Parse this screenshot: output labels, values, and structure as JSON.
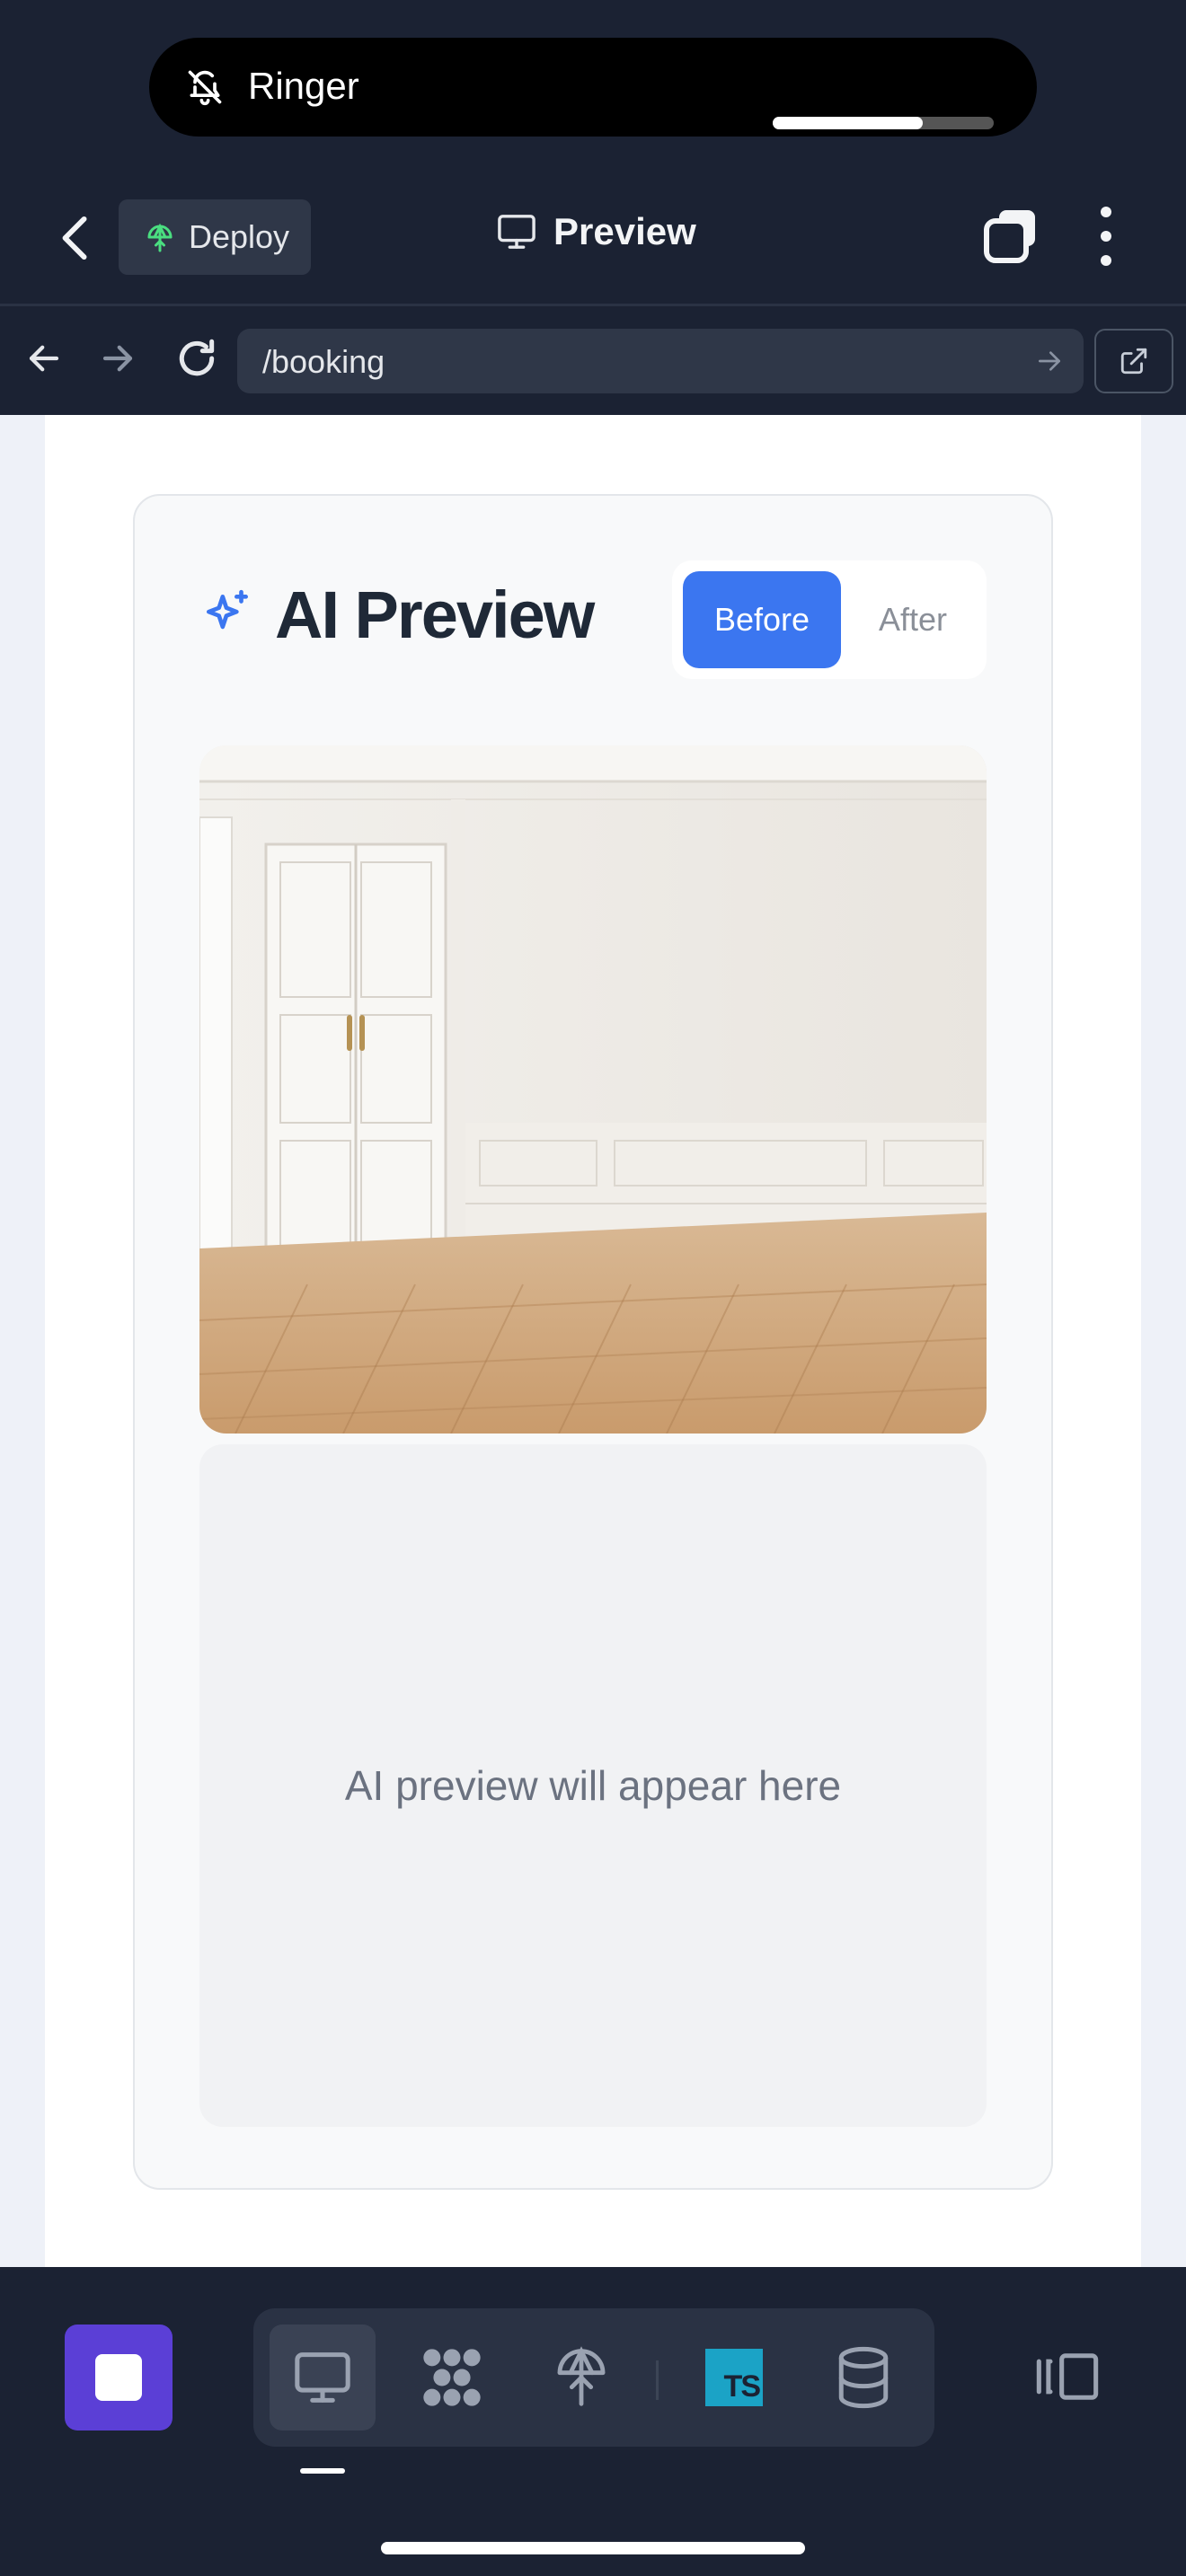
{
  "status": {
    "ringer_label": "Ringer",
    "volume_level": 0.68
  },
  "header": {
    "deploy_label": "Deploy",
    "title": "Preview"
  },
  "browser": {
    "url": "/booking"
  },
  "card": {
    "title": "AI Preview",
    "toggle": {
      "before_label": "Before",
      "after_label": "After",
      "selected": "Before"
    },
    "placeholder_text": "AI preview will appear here"
  },
  "colors": {
    "accent": "#3b76f0",
    "stop_button": "#5b3fd6",
    "deploy_icon": "#4ade80",
    "ts_badge": "#1ba3c6"
  },
  "dock": {
    "tabs": [
      "monitor-icon",
      "nodes-icon",
      "deploy-icon",
      "typescript-icon",
      "database-icon"
    ],
    "active_tab": "monitor-icon",
    "ts_text": "TS"
  }
}
